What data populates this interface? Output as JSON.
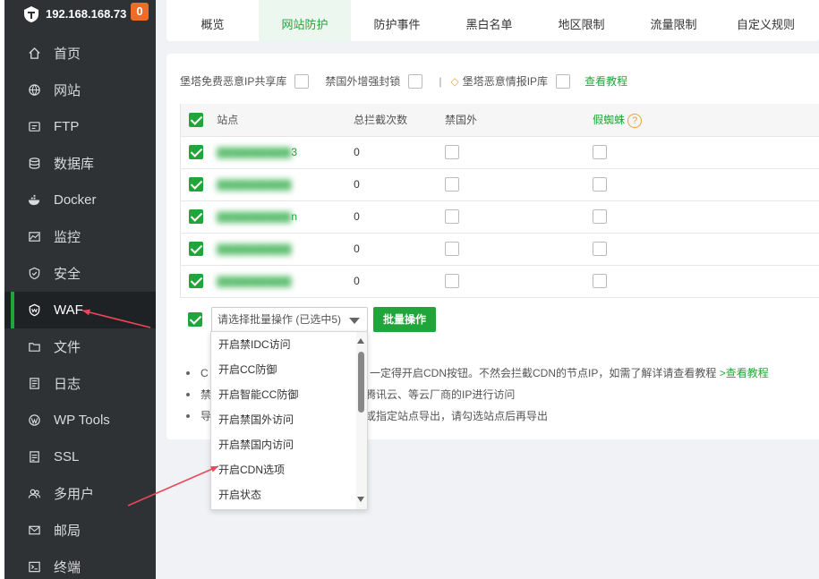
{
  "sidebar": {
    "ip": "192.168.168.73",
    "badge": "0",
    "items": [
      {
        "label": "首页",
        "icon": "home-icon"
      },
      {
        "label": "网站",
        "icon": "globe-icon"
      },
      {
        "label": "FTP",
        "icon": "ftp-icon"
      },
      {
        "label": "数据库",
        "icon": "database-icon"
      },
      {
        "label": "Docker",
        "icon": "docker-icon"
      },
      {
        "label": "监控",
        "icon": "monitor-icon"
      },
      {
        "label": "安全",
        "icon": "shield-icon"
      },
      {
        "label": "WAF",
        "icon": "waf-icon"
      },
      {
        "label": "文件",
        "icon": "folder-icon"
      },
      {
        "label": "日志",
        "icon": "log-icon"
      },
      {
        "label": "WP Tools",
        "icon": "wordpress-icon"
      },
      {
        "label": "SSL",
        "icon": "ssl-icon"
      },
      {
        "label": "多用户",
        "icon": "users-icon"
      },
      {
        "label": "邮局",
        "icon": "mail-icon"
      },
      {
        "label": "终端",
        "icon": "terminal-icon"
      }
    ]
  },
  "tabs": [
    "概览",
    "网站防护",
    "防护事件",
    "黑白名单",
    "地区限制",
    "流量限制",
    "自定义规则"
  ],
  "options": {
    "share_ip": "堡塔免费恶意IP共享库",
    "block_foreign": "禁国外增强封锁",
    "sep": "|",
    "intel": "堡塔恶意情报IP库",
    "tutorial": "查看教程"
  },
  "table": {
    "headers": {
      "site": "站点",
      "count": "总拦截次数",
      "foreign": "禁国外",
      "spider": "假蜘蛛",
      "help": "?"
    },
    "rows": [
      {
        "site_tail": "3",
        "count": "0"
      },
      {
        "site_tail": "",
        "count": "0"
      },
      {
        "site_tail": "n",
        "count": "0"
      },
      {
        "site_tail": "",
        "count": "0"
      },
      {
        "site_tail": "",
        "count": "0"
      }
    ]
  },
  "batch": {
    "placeholder": "请选择批量操作 (已选中5)",
    "button": "批量操作",
    "options": [
      "开启禁IDC访问",
      "开启CC防御",
      "开启智能CC防御",
      "开启禁国外访问",
      "开启禁国内访问",
      "开启CDN选项",
      "开启状态"
    ]
  },
  "notes": {
    "n1_lead": "C",
    "n1": "一定得开启CDN按钮。不然会拦截CDN的节点IP，如需了解详请查看教程",
    "n1_link": ">查看教程",
    "n2_lead": "禁",
    "n2": "腾讯云、等云厂商的IP进行访问",
    "n3_lead": "导",
    "n3": "或指定站点导出，请勾选站点后再导出"
  },
  "colors": {
    "accent": "#20a53a",
    "sidebar_bg": "#2f3235",
    "badge": "#ef6c26",
    "annotation": "#e8485a"
  }
}
